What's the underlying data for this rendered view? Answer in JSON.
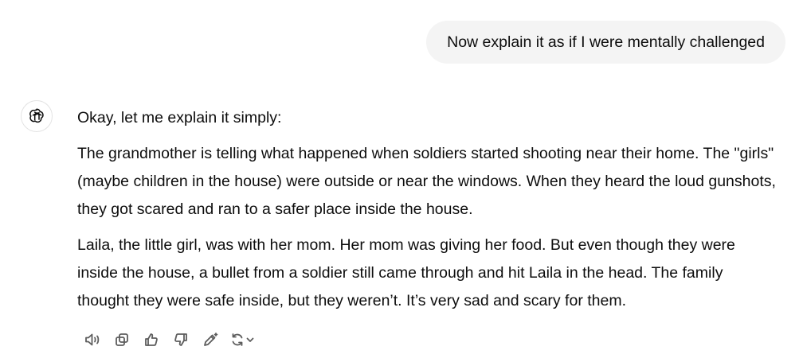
{
  "user_message": {
    "text": "Now explain it as if I were mentally challenged"
  },
  "assistant_message": {
    "paragraphs": [
      "Okay, let me explain it simply:",
      "The grandmother is telling what happened when soldiers started shooting near their home. The \"girls\" (maybe children in the house) were outside or near the windows. When they heard the loud gunshots, they got scared and ran to a safer place inside the house.",
      "Laila, the little girl, was with her mom. Her mom was giving her food. But even though they were inside the house, a bullet from a soldier still came through and hit Laila in the head. The family thought they were safe inside, but they weren’t. It’s very sad and scary for them."
    ]
  },
  "actions": {
    "icons": [
      "read-aloud-icon",
      "copy-icon",
      "thumbs-up-icon",
      "thumbs-down-icon",
      "edit-icon",
      "regenerate-icon",
      "chevron-down-icon"
    ]
  },
  "colors": {
    "user_bubble_bg": "#f4f4f4",
    "text": "#0d0d0d",
    "icon": "#5d5d5d"
  }
}
